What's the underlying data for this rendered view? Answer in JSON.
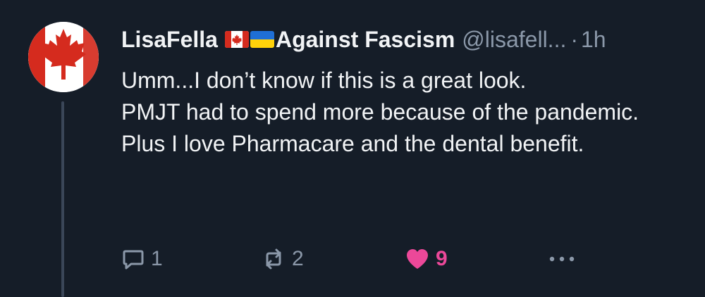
{
  "post": {
    "author": {
      "display_name": "LisaFella",
      "name_suffix": "Against Fascism",
      "flags": [
        "canada-flag",
        "ukraine-flag"
      ],
      "handle": "@lisafell...",
      "avatar_icon": "canada-maple-leaf-avatar"
    },
    "separator": "·",
    "timestamp": "1h",
    "body": [
      "Umm...I don’t know if this is a great look.",
      "PMJT had to spend more because of the pandemic.",
      "Plus I love Pharmacare and the dental benefit."
    ],
    "actions": {
      "reply": {
        "icon": "reply-icon",
        "count": "1"
      },
      "repost": {
        "icon": "repost-icon",
        "count": "2"
      },
      "like": {
        "icon": "heart-icon",
        "count": "9",
        "liked": true
      },
      "more": {
        "icon": "more-icon"
      }
    }
  },
  "colors": {
    "background": "#151d28",
    "text": "#f1f3f5",
    "muted": "#8b98a9",
    "like": "#ec4899",
    "thread_line": "#3a4658"
  }
}
